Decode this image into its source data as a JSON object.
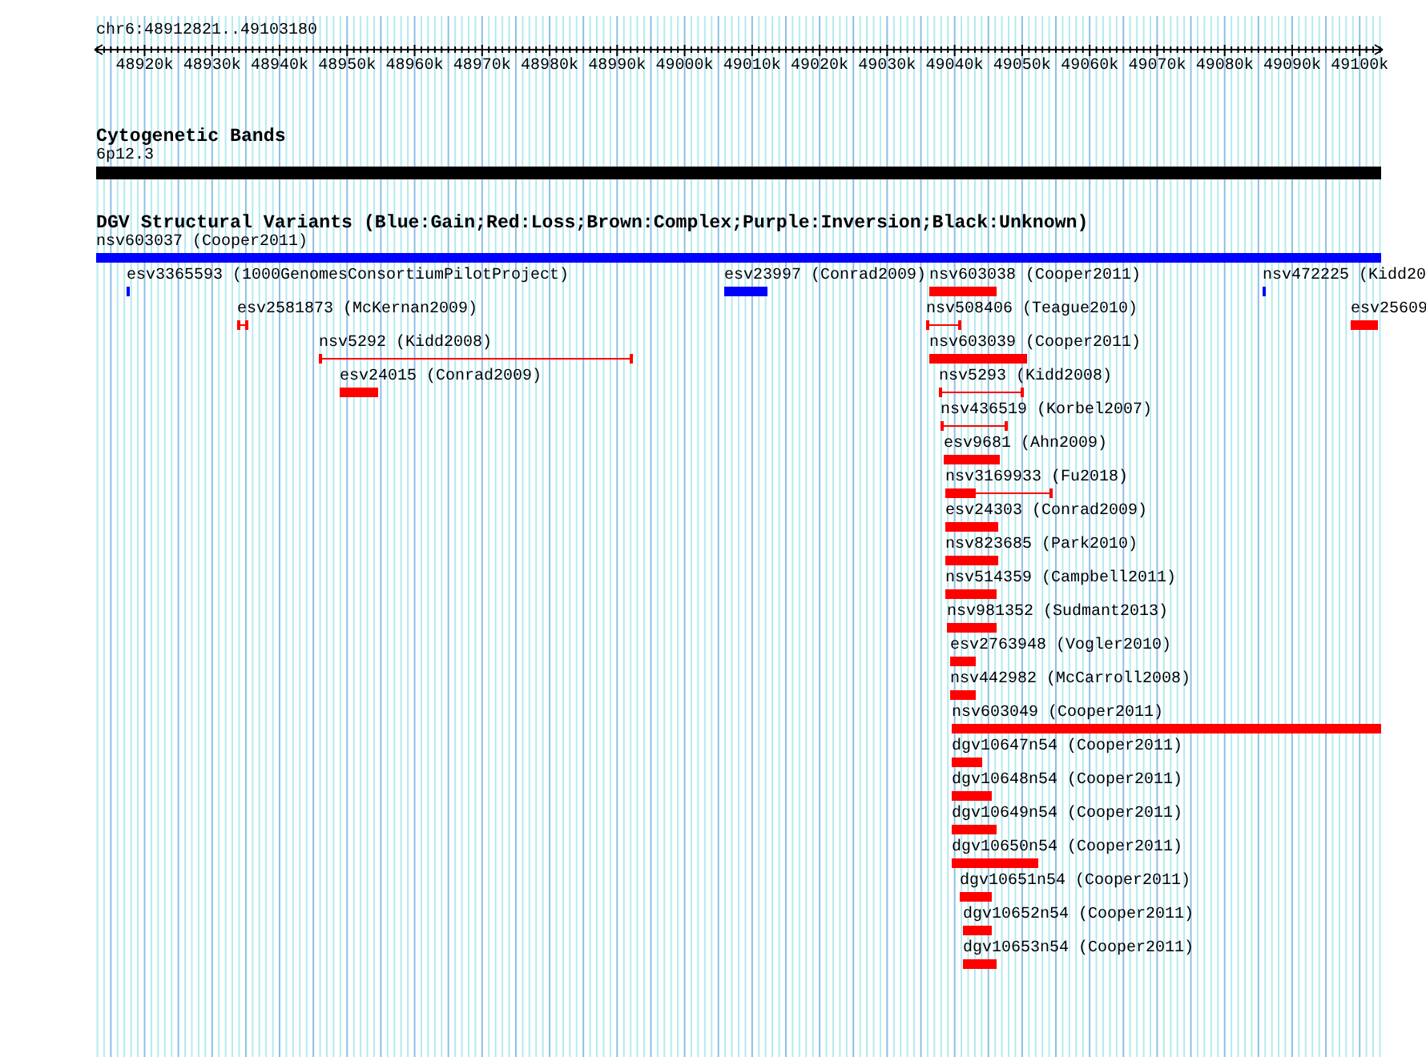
{
  "location": "chr6:48912821..49103180",
  "ruler": {
    "ticks": [
      "48920k",
      "48930k",
      "48940k",
      "48950k",
      "48960k",
      "48970k",
      "48980k",
      "48990k",
      "49000k",
      "49010k",
      "49020k",
      "49030k",
      "49040k",
      "49050k",
      "49060k",
      "49070k",
      "49080k",
      "49090k",
      "49100k"
    ]
  },
  "tracks": [
    {
      "kind": "bands",
      "title": "Cytogenetic Bands",
      "features": [
        {
          "label": "6p12.3",
          "kind": "bar",
          "color": "#000000"
        }
      ]
    },
    {
      "kind": "variants",
      "title": "DGV Structural Variants (Blue:Gain;Red:Loss;Brown:Complex;Purple:Inversion;Black:Unknown)",
      "features": [
        {
          "label": "nsv603037 (Cooper2011)",
          "kind": "bar",
          "color": "#0000ff"
        },
        {
          "label": "esv3365593 (1000GenomesConsortiumPilotProject)",
          "kind": "bar",
          "color": "#0000ff"
        },
        {
          "label": "esv23997 (Conrad2009)",
          "kind": "bar",
          "color": "#0000ff"
        },
        {
          "label": "nsv603038 (Cooper2011)",
          "kind": "bar",
          "color": "#ff0000"
        },
        {
          "label": "nsv472225 (Kidd20",
          "kind": "bar",
          "color": "#0000ff"
        },
        {
          "label": "esv2581873 (McKernan2009)",
          "kind": "interval",
          "color": "#ff0000"
        },
        {
          "label": "nsv508406 (Teague2010)",
          "kind": "interval",
          "color": "#ff0000"
        },
        {
          "label": "esv25609",
          "kind": "bar",
          "color": "#ff0000"
        },
        {
          "label": "nsv5292 (Kidd2008)",
          "kind": "interval",
          "color": "#ff0000"
        },
        {
          "label": "nsv603039 (Cooper2011)",
          "kind": "bar",
          "color": "#ff0000"
        },
        {
          "label": "esv24015 (Conrad2009)",
          "kind": "bar",
          "color": "#ff0000"
        },
        {
          "label": "nsv5293 (Kidd2008)",
          "kind": "interval",
          "color": "#ff0000"
        },
        {
          "label": "nsv436519 (Korbel2007)",
          "kind": "interval",
          "color": "#ff0000"
        },
        {
          "label": "esv9681 (Ahn2009)",
          "kind": "bar",
          "color": "#ff0000"
        },
        {
          "label": "nsv3169933 (Fu2018)",
          "kind": "mixed",
          "color": "#ff0000"
        },
        {
          "label": "esv24303 (Conrad2009)",
          "kind": "bar",
          "color": "#ff0000"
        },
        {
          "label": "nsv823685 (Park2010)",
          "kind": "bar",
          "color": "#ff0000"
        },
        {
          "label": "nsv514359 (Campbell2011)",
          "kind": "bar",
          "color": "#ff0000"
        },
        {
          "label": "nsv981352 (Sudmant2013)",
          "kind": "bar",
          "color": "#ff0000"
        },
        {
          "label": "esv2763948 (Vogler2010)",
          "kind": "bar",
          "color": "#ff0000"
        },
        {
          "label": "nsv442982 (McCarroll2008)",
          "kind": "bar",
          "color": "#ff0000"
        },
        {
          "label": "nsv603049 (Cooper2011)",
          "kind": "bar",
          "color": "#ff0000"
        },
        {
          "label": "dgv10647n54 (Cooper2011)",
          "kind": "bar",
          "color": "#ff0000"
        },
        {
          "label": "dgv10648n54 (Cooper2011)",
          "kind": "bar",
          "color": "#ff0000"
        },
        {
          "label": "dgv10649n54 (Cooper2011)",
          "kind": "bar",
          "color": "#ff0000"
        },
        {
          "label": "dgv10650n54 (Cooper2011)",
          "kind": "bar",
          "color": "#ff0000"
        },
        {
          "label": "dgv10651n54 (Cooper2011)",
          "kind": "bar",
          "color": "#ff0000"
        },
        {
          "label": "dgv10652n54 (Cooper2011)",
          "kind": "bar",
          "color": "#ff0000"
        },
        {
          "label": "dgv10653n54 (Cooper2011)",
          "kind": "bar",
          "color": "#ff0000"
        }
      ]
    }
  ]
}
